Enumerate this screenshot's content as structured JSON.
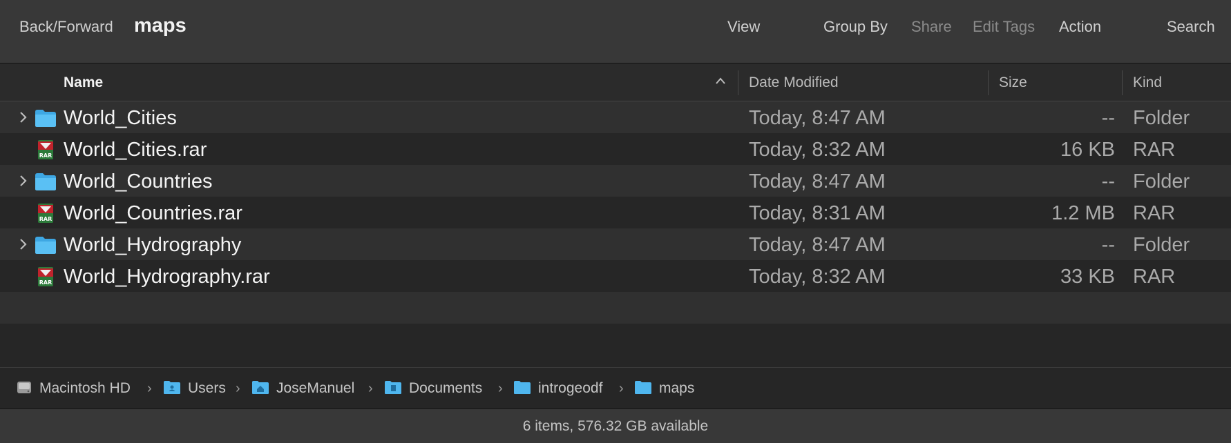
{
  "toolbar": {
    "back_forward_label": "Back/Forward",
    "title": "maps",
    "view_label": "View",
    "group_by_label": "Group By",
    "share_label": "Share",
    "edit_tags_label": "Edit Tags",
    "action_label": "Action",
    "search_label": "Search"
  },
  "columns": {
    "name": "Name",
    "date_modified": "Date Modified",
    "size": "Size",
    "kind": "Kind",
    "sort_icon": "chevron-up-icon"
  },
  "files": [
    {
      "name": "World_Cities",
      "date": "Today, 8:47 AM",
      "size": "--",
      "kind": "Folder",
      "icon": "folder-icon",
      "expandable": true
    },
    {
      "name": "World_Cities.rar",
      "date": "Today, 8:32 AM",
      "size": "16 KB",
      "kind": "RAR",
      "icon": "rar-archive-icon",
      "expandable": false
    },
    {
      "name": "World_Countries",
      "date": "Today, 8:47 AM",
      "size": "--",
      "kind": "Folder",
      "icon": "folder-icon",
      "expandable": true
    },
    {
      "name": "World_Countries.rar",
      "date": "Today, 8:31 AM",
      "size": "1.2 MB",
      "kind": "RAR",
      "icon": "rar-archive-icon",
      "expandable": false
    },
    {
      "name": "World_Hydrography",
      "date": "Today, 8:47 AM",
      "size": "--",
      "kind": "Folder",
      "icon": "folder-icon",
      "expandable": true
    },
    {
      "name": "World_Hydrography.rar",
      "date": "Today, 8:32 AM",
      "size": "33 KB",
      "kind": "RAR",
      "icon": "rar-archive-icon",
      "expandable": false
    }
  ],
  "path": [
    {
      "label": "Macintosh HD",
      "icon": "hard-drive-icon"
    },
    {
      "label": "Users",
      "icon": "users-folder-icon"
    },
    {
      "label": "JoseManuel",
      "icon": "home-folder-icon"
    },
    {
      "label": "Documents",
      "icon": "documents-folder-icon"
    },
    {
      "label": "introgeodf",
      "icon": "folder-icon"
    },
    {
      "label": "maps",
      "icon": "folder-icon"
    }
  ],
  "path_separator": "›",
  "status": "6 items, 576.32 GB available",
  "colors": {
    "folder_blue": "#4fb6ee",
    "rar_red": "#c0232c",
    "rar_green": "#2c7a3a",
    "toolbar_bg": "#383838",
    "list_bg": "#262626"
  }
}
